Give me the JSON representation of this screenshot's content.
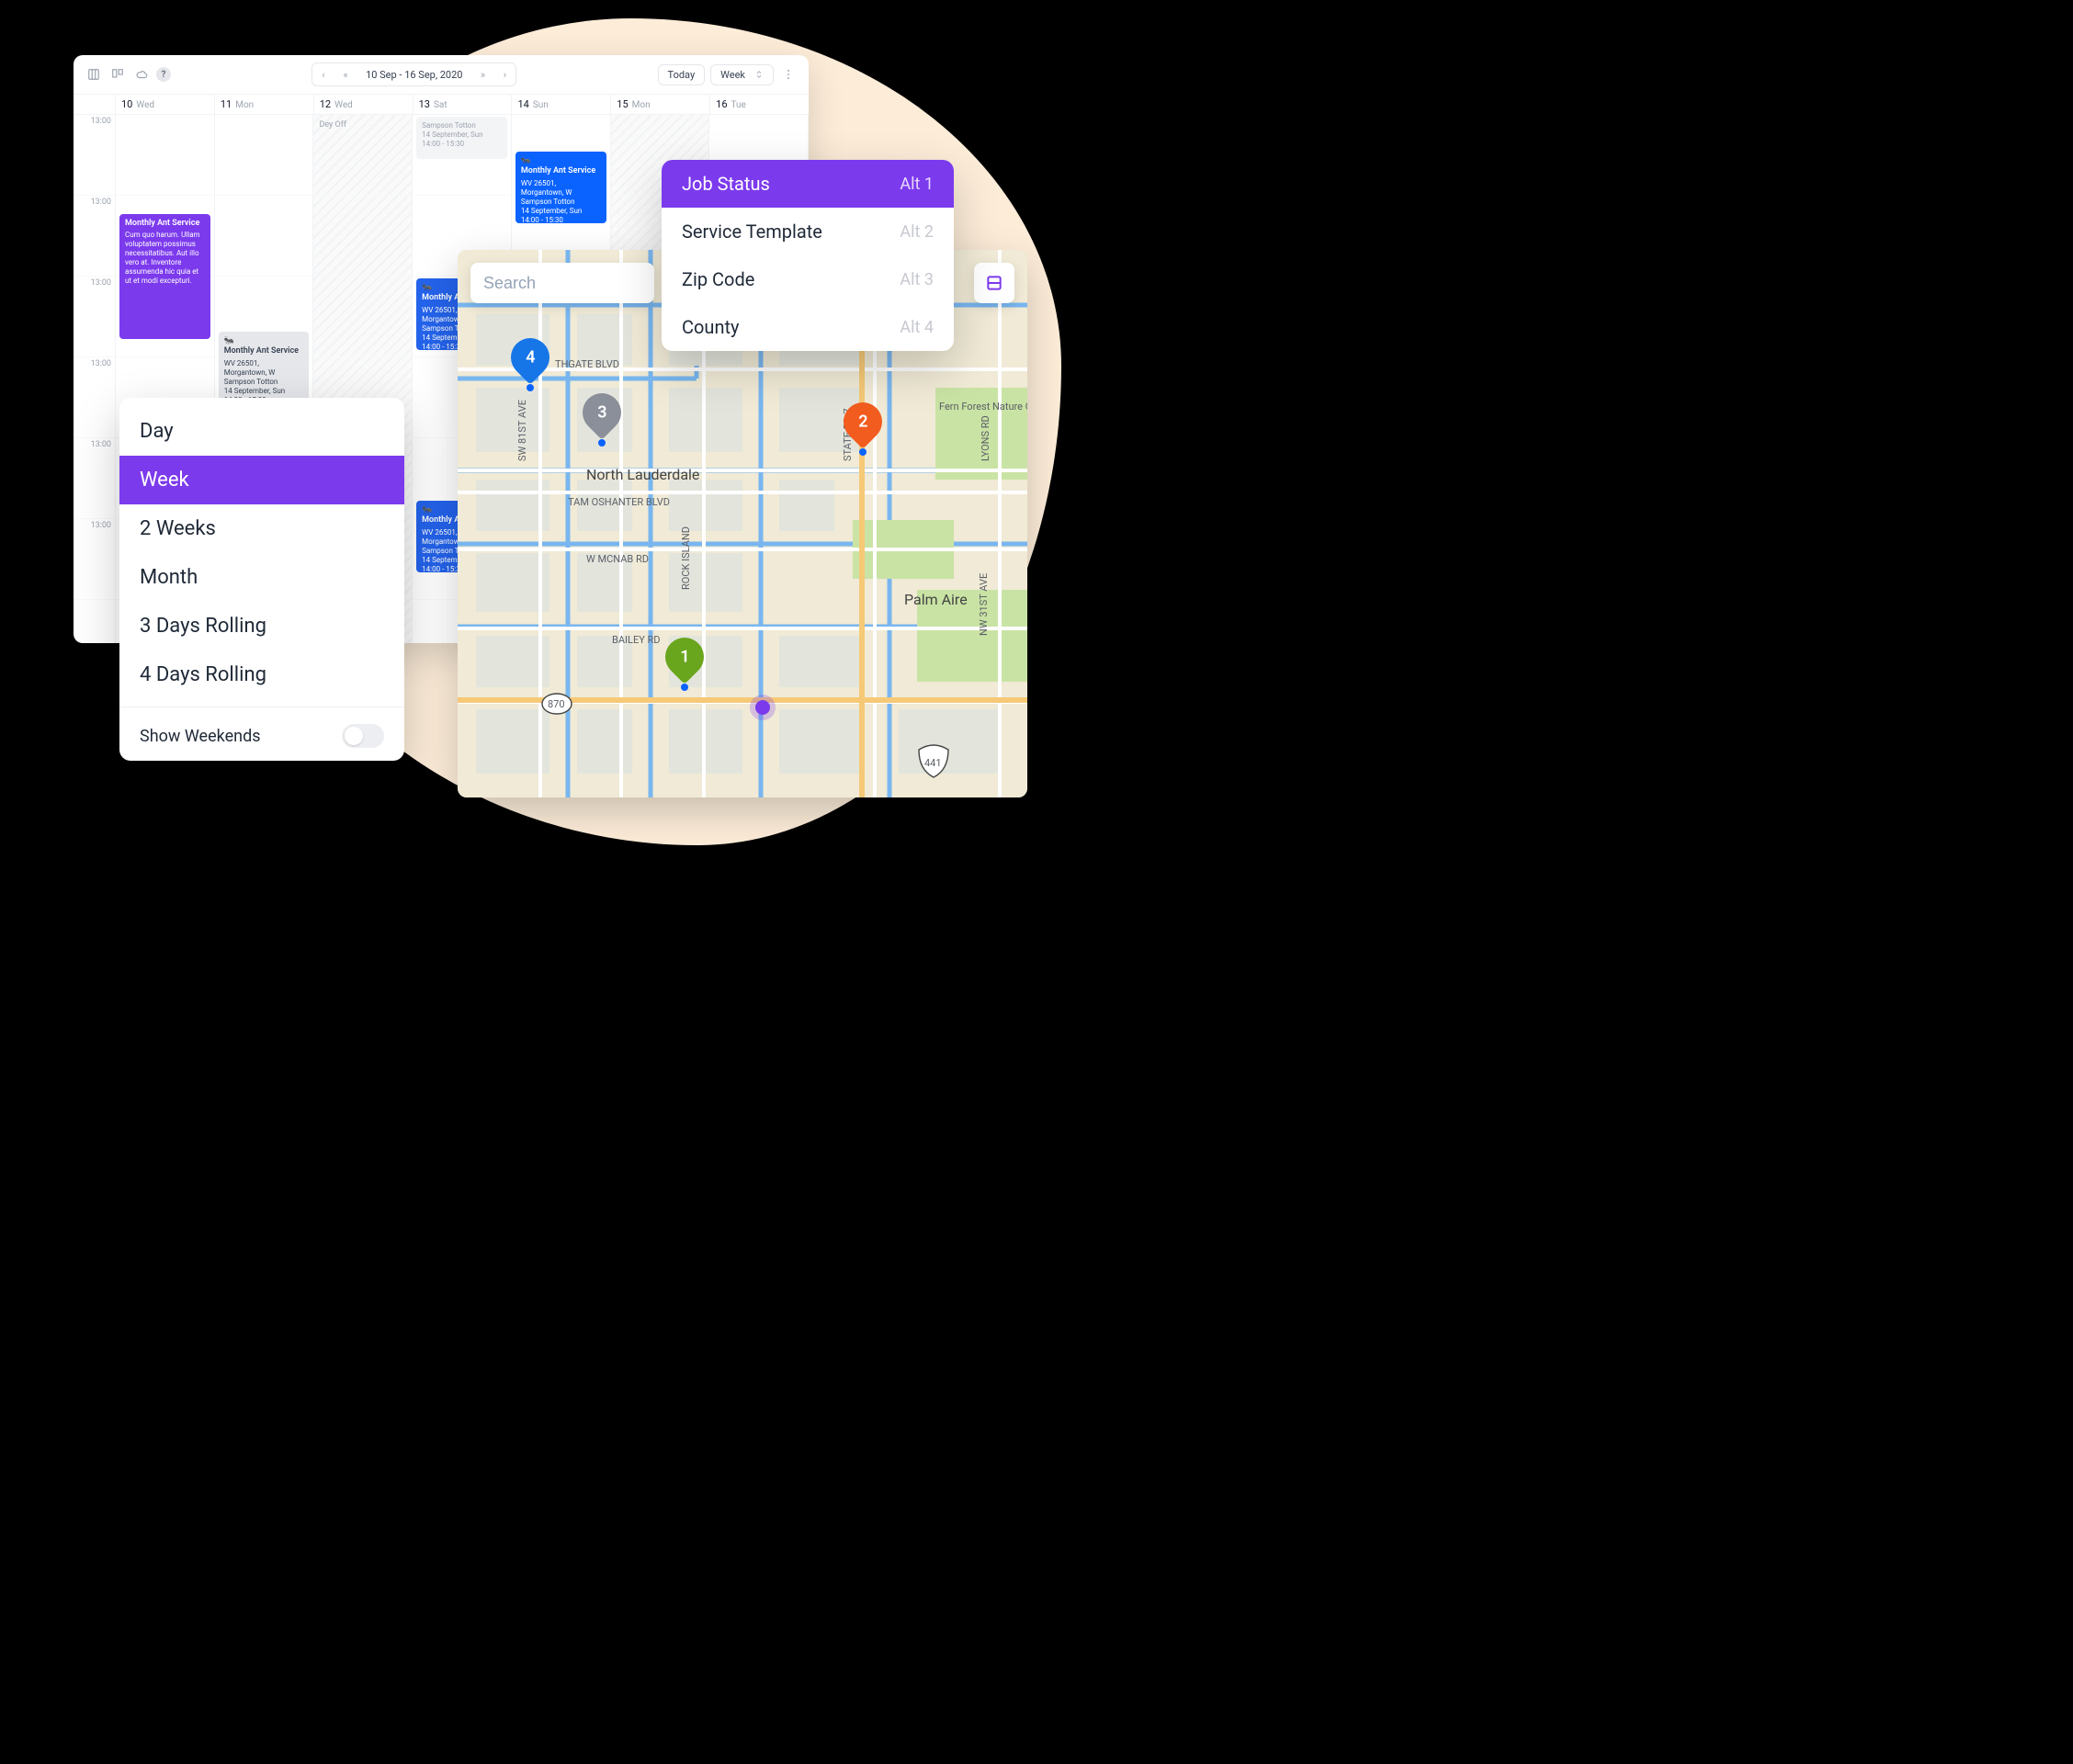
{
  "toolbar": {
    "dateRange": "10 Sep - 16 Sep, 2020",
    "today": "Today",
    "viewSelect": "Week"
  },
  "days": [
    {
      "num": "10",
      "dow": "Wed"
    },
    {
      "num": "11",
      "dow": "Mon"
    },
    {
      "num": "12",
      "dow": "Wed"
    },
    {
      "num": "13",
      "dow": "Sat"
    },
    {
      "num": "14",
      "dow": "Sun"
    },
    {
      "num": "15",
      "dow": "Mon"
    },
    {
      "num": "16",
      "dow": "Tue"
    }
  ],
  "hours": [
    "13:00",
    "13:00",
    "13:00",
    "13:00",
    "13:00",
    "13:00"
  ],
  "dayOff": "Dey Off",
  "events": {
    "purple": {
      "title": "Monthly Ant Service",
      "body": "Cum quo harum. Ullam voluptatem possimus necessitatibus. Aut illo vero at. Inventore assumenda hic quia et ut et modi excepturi."
    },
    "detail": {
      "title": "Monthly Ant Service",
      "l1": "WV 26501, Morgantown, W",
      "l2": "Sampson Totton",
      "l3": "14 September, Sun",
      "l4": "14:00 - 15:30"
    },
    "dim1": {
      "l2": "Sampson Totton",
      "l3": "14 September, Sun",
      "l4": "14:00 - 15:30"
    }
  },
  "viewMenu": {
    "items": [
      "Day",
      "Week",
      "2 Weeks",
      "Month",
      "3 Days Rolling",
      "4 Days Rolling"
    ],
    "activeIndex": 1,
    "toggleLabel": "Show Weekends"
  },
  "filterMenu": {
    "rows": [
      {
        "label": "Job Status",
        "key": "Alt 1"
      },
      {
        "label": "Service Template",
        "key": "Alt 2"
      },
      {
        "label": "Zip Code",
        "key": "Alt 3"
      },
      {
        "label": "County",
        "key": "Alt 4"
      }
    ],
    "activeIndex": 0
  },
  "search": {
    "placeholder": "Search"
  },
  "pins": {
    "p1": "1",
    "p2": "2",
    "p3": "3",
    "p4": "4"
  },
  "map": {
    "labels": {
      "northgate": "THGATE BLVD",
      "sw81": "SW 81ST AVE",
      "northL": "North Lauderdale",
      "tam": "TAM OSHANTER BLVD",
      "mcnab": "W MCNAB RD",
      "bailey": "BAILEY RD",
      "sr7": "STATE RD 7",
      "rockIsland": "ROCK ISLAND",
      "lyons": "LYONS RD",
      "palmAire": "Palm Aire",
      "fern": "Fern Forest Nature Center",
      "nw31": "NW 31ST AVE",
      "r870": "870",
      "r441": "441"
    }
  }
}
